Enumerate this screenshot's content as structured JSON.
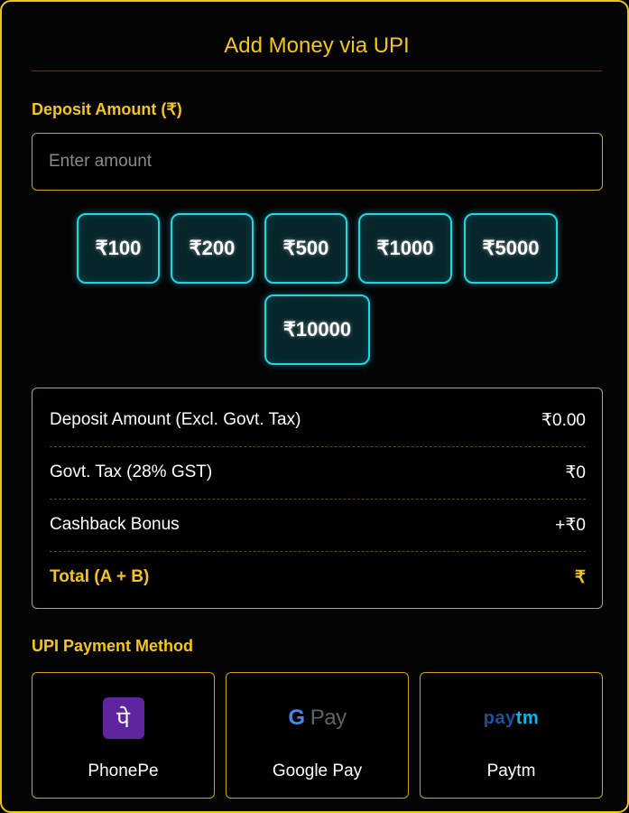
{
  "header": {
    "title": "Add Money via UPI"
  },
  "deposit": {
    "label": "Deposit Amount (₹)",
    "placeholder": "Enter amount",
    "presets": [
      "₹100",
      "₹200",
      "₹500",
      "₹1000",
      "₹5000",
      "₹10000"
    ]
  },
  "summary": {
    "rows": [
      {
        "label": "Deposit Amount (Excl. Govt. Tax)",
        "value": "₹0.00"
      },
      {
        "label": "Govt. Tax (28% GST)",
        "value": "₹0"
      },
      {
        "label": "Cashback Bonus",
        "value": "+₹0"
      },
      {
        "label": "Total (A + B)",
        "value": "₹"
      }
    ]
  },
  "payment": {
    "label": "UPI Payment Method",
    "methods": [
      {
        "name": "PhonePe",
        "icon": "phonepe-logo",
        "logo_text": "पे"
      },
      {
        "name": "Google Pay",
        "icon": "google-pay-logo",
        "logo_text": "G Pay"
      },
      {
        "name": "Paytm",
        "icon": "paytm-logo",
        "logo_text": "paytm"
      }
    ]
  },
  "colors": {
    "accent": "#f5c518",
    "preset_border": "#1fd6e6",
    "phonepe": "#5f259f",
    "paytm_dark": "#002e6e",
    "paytm_light": "#00baf2"
  }
}
